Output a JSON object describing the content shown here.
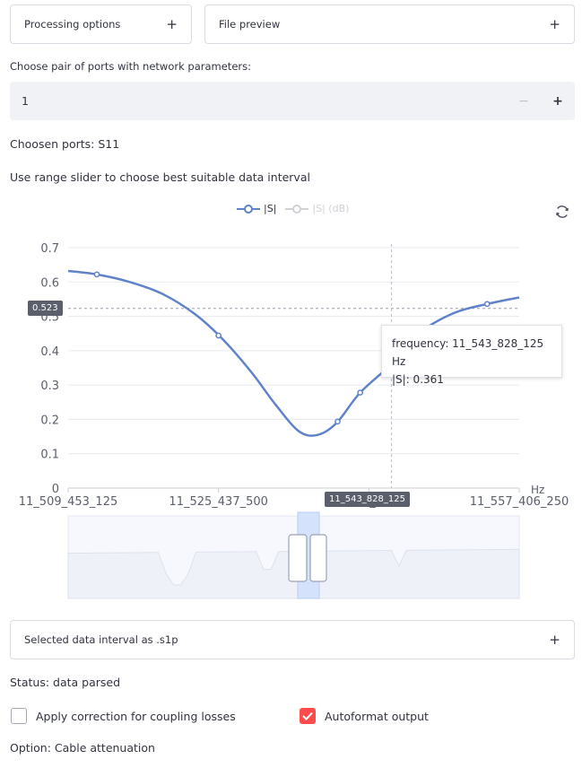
{
  "expanders": {
    "processing_options": "Processing options",
    "file_preview": "File preview",
    "selected_interval": "Selected data interval as .s1p",
    "plus": "+"
  },
  "port_select": {
    "label": "Choose pair of ports with network parameters:",
    "value": "1",
    "minus": "−",
    "plus": "+"
  },
  "chosen_ports": "Choosen ports: S11",
  "range_hint": "Use range slider to choose best suitable data interval",
  "legend": {
    "series_1": "|S|",
    "series_2": "|S| (dB)"
  },
  "icons": {
    "reset": "reset-axes-icon",
    "checkmark": "checkmark-icon"
  },
  "hover": {
    "y_badge": "0.523",
    "x_badge": "11_543_828_125",
    "tooltip_line1": "frequency: 11_543_828_125 Hz",
    "tooltip_line2": "|S|: 0.361"
  },
  "chart_data": {
    "type": "line",
    "xunit": "Hz",
    "x_ticks": [
      "11_509_453_125",
      "11_525_437_500",
      "11_5",
      "11_557_406_250"
    ],
    "y_ticks": [
      "0",
      "0.1",
      "0.2",
      "0.3",
      "0.4",
      "0.5",
      "0.6",
      "0.7"
    ],
    "ylim": [
      0,
      0.7
    ],
    "xlim": [
      11509453125,
      11557406250
    ],
    "grid": true,
    "legend_position": "top",
    "color": "#6082c9",
    "series": [
      {
        "name": "|S|",
        "x": [
          11509453125,
          11512500000,
          11516000000,
          11519500000,
          11523000000,
          11526000000,
          11529000000,
          11531500000,
          11534000000,
          11536000000,
          11538000000,
          11540500000,
          11543828125,
          11547000000,
          11550500000,
          11554000000,
          11557406250
        ],
        "y": [
          0.632,
          0.622,
          0.6,
          0.565,
          0.505,
          0.43,
          0.335,
          0.243,
          0.165,
          0.155,
          0.19,
          0.278,
          0.361,
          0.455,
          0.51,
          0.536,
          0.555
        ]
      }
    ],
    "markers_x": [
      11512500000,
      11525437500,
      11538100000,
      11540500000,
      11543828125,
      11554000000
    ],
    "hover_x": 11543828125,
    "hover_y": 0.523
  },
  "status": "Status: data parsed",
  "checkboxes": {
    "coupling": {
      "label": "Apply correction for coupling losses",
      "checked": false
    },
    "autoformat": {
      "label": "Autoformat output",
      "checked": true
    }
  },
  "option": "Option: Cable attenuation"
}
